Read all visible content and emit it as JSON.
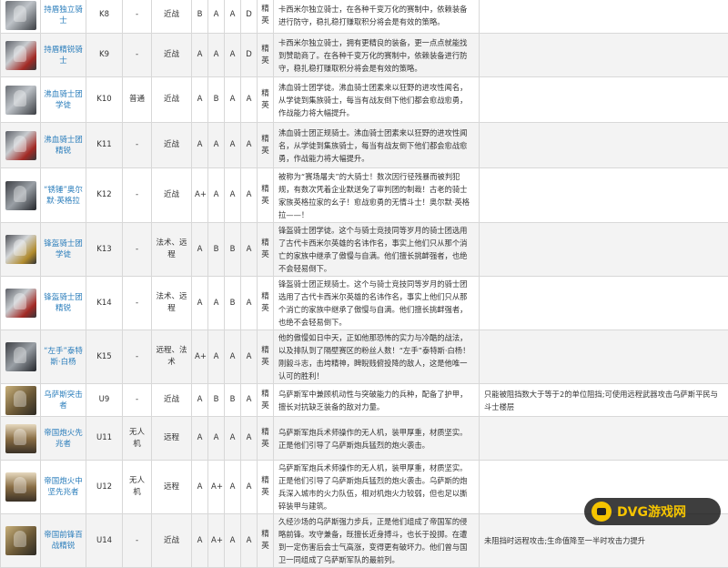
{
  "rows": [
    {
      "name": "持盾独立骑士",
      "code": "K8",
      "tag": "-",
      "range": "近战",
      "g1": "B",
      "g2": "A",
      "g3": "A",
      "g4": "D",
      "rank": "精英",
      "desc": "卡西米尔独立骑士，在各种千变万化的赛制中，依赖装备进行防守，稳扎稳打赚取积分将会是有效的策略。",
      "note": "",
      "portrait": "knight"
    },
    {
      "name": "持盾精锐骑士",
      "code": "K9",
      "tag": "-",
      "range": "近战",
      "g1": "A",
      "g2": "A",
      "g3": "A",
      "g4": "D",
      "rank": "精英",
      "desc": "卡西米尔独立骑士，拥有更精良的装备，更一点点就能找到赞助商了。在各种千变万化的赛制中，依赖装备进行防守，稳扎稳打赚取积分将会是有效的策略。",
      "note": "",
      "portrait": "red"
    },
    {
      "name": "沸血骑士团学徒",
      "code": "K10",
      "tag": "普通",
      "range": "近战",
      "g1": "A",
      "g2": "B",
      "g3": "A",
      "g4": "A",
      "rank": "精英",
      "desc": "沸血骑士团学徒。沸血骑士团素来以狂野的进攻性闻名，从学徒到集族骑士，每当有战友倒下他们都会愈战愈勇，作战能力将大幅提升。",
      "note": "",
      "portrait": "knight"
    },
    {
      "name": "沸血骑士团精锐",
      "code": "K11",
      "tag": "-",
      "range": "近战",
      "g1": "A",
      "g2": "A",
      "g3": "A",
      "g4": "A",
      "rank": "精英",
      "desc": "沸血骑士团正规骑士。沸血骑士团素来以狂野的进攻性闻名，从学徒到集族骑士，每当有战友倒下他们都会愈战愈勇，作战能力将大幅提升。",
      "note": "",
      "portrait": "red"
    },
    {
      "name": "“锈锤”奥尔默·英格拉",
      "code": "K12",
      "tag": "-",
      "range": "近战",
      "g1": "A+",
      "g2": "A",
      "g3": "A",
      "g4": "A",
      "rank": "精英",
      "desc": "被称为“赛场屠夫”的大骑士！数次因行径残暴而被判犯规，有数次凭着企业默送免了审判团的制裁！古老的骑士家族英格拉家的幺子！愈战愈勇的无情斗士！奥尔默·英格拉——！",
      "note": "",
      "portrait": "dark"
    },
    {
      "name": "锋盔骑士团学徒",
      "code": "K13",
      "tag": "-",
      "range": "法术、远程",
      "g1": "A",
      "g2": "B",
      "g3": "B",
      "g4": "A",
      "rank": "精英",
      "desc": "锋盔骑士团学徒。这个与骑士竞技同等岁月的骑士团选用了古代卡西米尔英雄的名讳作名，事实上他们只从那个消亡的家族中继承了傲慢与自满。他们擅长挑衅强者，也绝不会轻易倒下。",
      "note": "",
      "portrait": "gold"
    },
    {
      "name": "锋盔骑士团精锐",
      "code": "K14",
      "tag": "-",
      "range": "法术、远程",
      "g1": "A",
      "g2": "A",
      "g3": "B",
      "g4": "A",
      "rank": "精英",
      "desc": "锋盔骑士团正规骑士。这个与骑士竞技同等岁月的骑士团选用了古代卡西米尔英雄的名讳作名，事实上他们只从那个消亡的家族中继承了傲慢与自满。他们擅长挑衅强者，也绝不会轻易倒下。",
      "note": "",
      "portrait": "red"
    },
    {
      "name": "“左手”泰特斯·白杨",
      "code": "K15",
      "tag": "-",
      "range": "远程、法术",
      "g1": "A+",
      "g2": "A",
      "g3": "A",
      "g4": "A",
      "rank": "精英",
      "desc": "他的傲慢如日中天，正如他那恐怖的实力与冷酷的战法，以及排队到了隔壁赛区的粉丝人数！“左手”泰特斯·白杨！刚毅斗志，击垮精神，睥睨贱俯投降的敌人，这是他唯一认可的胜利！",
      "note": "",
      "portrait": "dark"
    },
    {
      "name": "乌萨斯突击者",
      "code": "U9",
      "tag": "-",
      "range": "近战",
      "g1": "A",
      "g2": "B",
      "g3": "B",
      "g4": "A",
      "rank": "精英",
      "desc": "乌萨斯军中兼顾机动性与突破能力的兵种，配备了护甲，擅长对抗缺乏装备的敌对力量。",
      "note": "只能被阻挡数大于等于2的单位阻挡;可使用远程武器攻击乌萨斯平民与斗士楼层",
      "portrait": "soldier"
    },
    {
      "name": "帝国炮火先兆者",
      "code": "U11",
      "tag": "无人机",
      "range": "远程",
      "g1": "A",
      "g2": "A",
      "g3": "A",
      "g4": "A",
      "rank": "精英",
      "desc": "乌萨斯军炮兵术师操作的无人机，装甲厚重，材质坚实。正是他们引导了乌萨斯炮兵猛烈的炮火袭击。",
      "note": "",
      "portrait": "drone"
    },
    {
      "name": "帝国炮火中坚先兆者",
      "code": "U12",
      "tag": "无人机",
      "range": "远程",
      "g1": "A",
      "g2": "A+",
      "g3": "A",
      "g4": "A",
      "rank": "精英",
      "desc": "乌萨斯军炮兵术师操作的无人机，装甲厚重，材质坚实。正是他们引导了乌萨斯炮兵猛烈的炮火袭击。乌萨斯的炮兵深入城市的火力队伍，相对机炮火力较弱，但也足以撕碎装甲与建筑。",
      "note": "",
      "portrait": "drone"
    },
    {
      "name": "帝国前锋百战精锐",
      "code": "U14",
      "tag": "-",
      "range": "近战",
      "g1": "A",
      "g2": "A+",
      "g3": "A",
      "g4": "A",
      "rank": "精英",
      "desc": "久经沙场的乌萨斯强力步兵，正是他们组成了帝国军的侵略前锋。攻守兼备，既擅长近身搏斗，也长于投掷。在遭到一定伤害后会士气高涨，变得更有破坏力。他们曾与国卫一同组成了乌萨斯军队的最前列。",
      "note": "未阻挡时远程攻击;生命值降至一半时攻击力提升",
      "portrait": "soldier"
    }
  ],
  "watermark": "DVG游戏网"
}
